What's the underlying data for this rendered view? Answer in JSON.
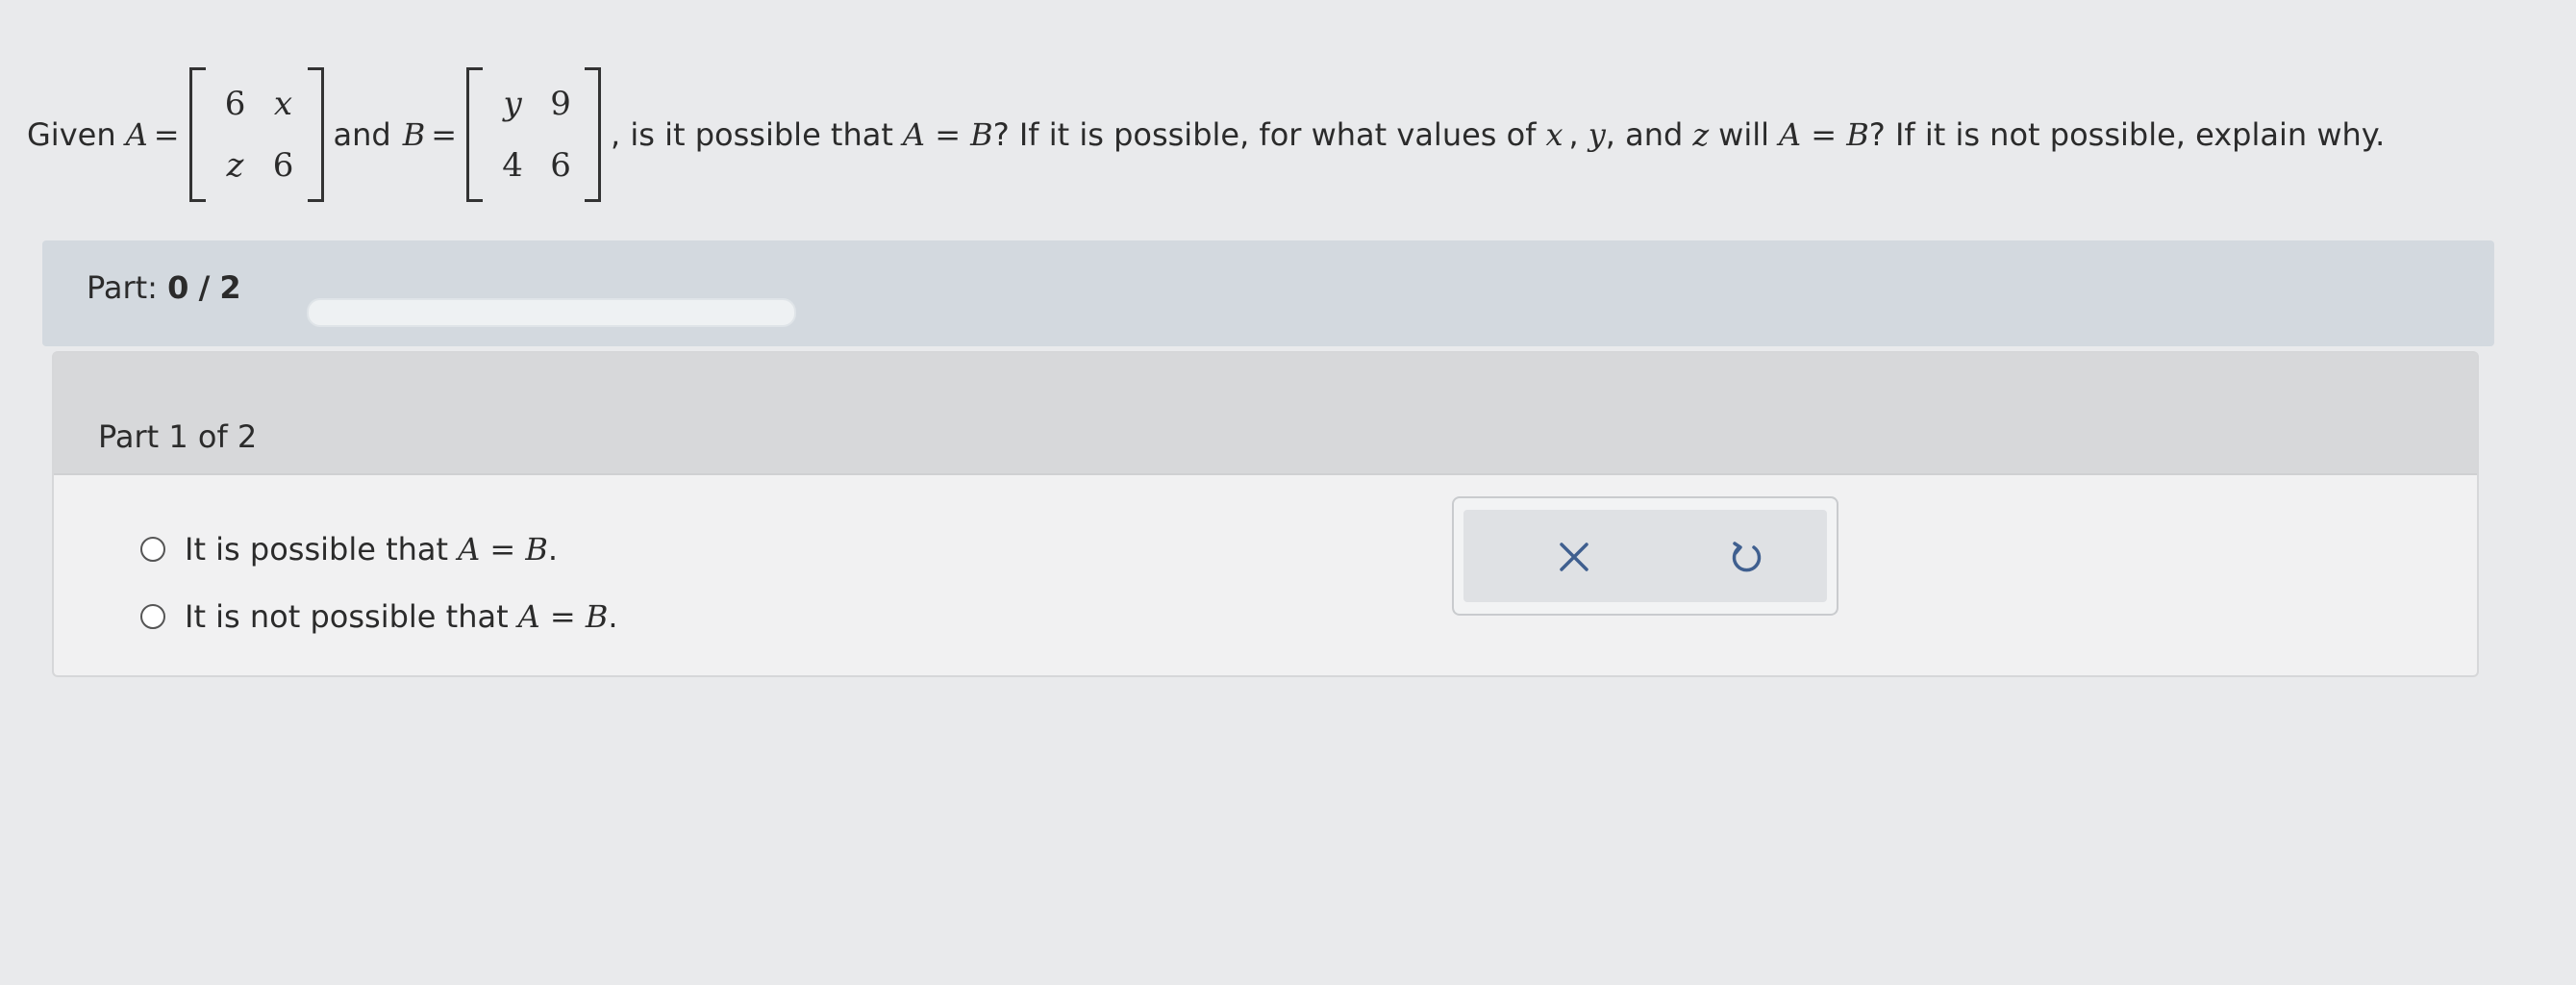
{
  "question": {
    "given": "Given",
    "var_a": "A",
    "eq": "=",
    "and": "and",
    "var_b": "B",
    "matrix_a": [
      [
        "6",
        "x"
      ],
      [
        "z",
        "6"
      ]
    ],
    "matrix_b": [
      [
        "y",
        "9"
      ],
      [
        "4",
        "6"
      ]
    ],
    "text_1": ", is it possible that",
    "a_eq_b": "A = B",
    "text_2": "? If it is possible, for what values of",
    "x": "x",
    "comma1": ",",
    "y": "y",
    "comma2": ", and",
    "z": "z",
    "text_3": "will",
    "text_4": "? If it is not possible, explain why."
  },
  "part_progress": {
    "label": "Part:",
    "current": "0",
    "sep": "/",
    "total": "2",
    "fill_fraction": 0
  },
  "part_card": {
    "title": "Part 1 of 2",
    "options": [
      {
        "prefix": "It is possible that",
        "math": "A = B",
        "suffix": "."
      },
      {
        "prefix": "It is not possible that",
        "math": "A = B",
        "suffix": "."
      }
    ]
  },
  "actions": {
    "clear_icon": "close-icon",
    "undo_icon": "undo-icon",
    "color": "#3f5f8f"
  }
}
